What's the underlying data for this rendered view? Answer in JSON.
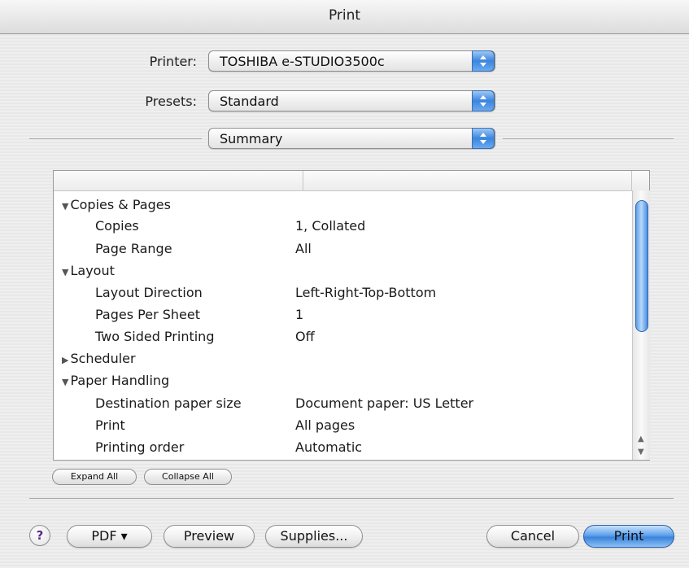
{
  "window": {
    "title": "Print"
  },
  "printer": {
    "label": "Printer:",
    "value": "TOSHIBA e-STUDIO3500c"
  },
  "presets": {
    "label": "Presets:",
    "value": "Standard"
  },
  "pane": {
    "value": "Summary"
  },
  "summary": {
    "rows": [
      {
        "label": "Copies & Pages",
        "value": "",
        "level": 0,
        "expanded": true
      },
      {
        "label": "Copies",
        "value": "1, Collated",
        "level": 1
      },
      {
        "label": "Page Range",
        "value": "All",
        "level": 1
      },
      {
        "label": "Layout",
        "value": "",
        "level": 0,
        "expanded": true
      },
      {
        "label": "Layout Direction",
        "value": "Left-Right-Top-Bottom",
        "level": 1
      },
      {
        "label": "Pages Per Sheet",
        "value": "1",
        "level": 1
      },
      {
        "label": "Two Sided Printing",
        "value": "Off",
        "level": 1
      },
      {
        "label": "Scheduler",
        "value": "",
        "level": 0,
        "expanded": false
      },
      {
        "label": "Paper Handling",
        "value": "",
        "level": 0,
        "expanded": true
      },
      {
        "label": "Destination paper size",
        "value": "Document paper: US Letter",
        "level": 1
      },
      {
        "label": "Print",
        "value": "All pages",
        "level": 1
      },
      {
        "label": "Printing order",
        "value": "Automatic",
        "level": 1
      }
    ]
  },
  "buttons": {
    "expand_all": "Expand All",
    "collapse_all": "Collapse All",
    "help": "?",
    "pdf": "PDF ▾",
    "preview": "Preview",
    "supplies": "Supplies...",
    "cancel": "Cancel",
    "print": "Print"
  },
  "colors": {
    "accent": "#3a83dc",
    "help_glyph": "#5a2a8a"
  }
}
